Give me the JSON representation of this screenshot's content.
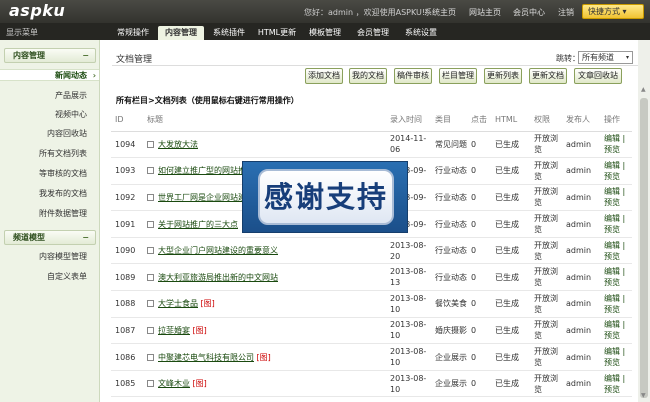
{
  "topbar": {
    "logo": "aspku",
    "welcome": "您好：admin ，欢迎使用ASPKU!",
    "links": [
      "系统主页",
      "网站主页",
      "会员中心",
      "注销"
    ],
    "shortcut": "快捷方式",
    "shortcut_arrow": "▾"
  },
  "navbar": {
    "menu_toggle": "显示菜单",
    "tabs": [
      "常规操作",
      "内容管理",
      "系统插件",
      "HTML更新",
      "模板管理",
      "会员管理",
      "系统设置"
    ],
    "active_tab": "内容管理"
  },
  "sidebar": {
    "sections": [
      {
        "title": "内容管理",
        "toggle": "−",
        "items": [
          "新闻动态",
          "产品展示",
          "视频中心",
          "内容回收站",
          "所有文档列表",
          "等审核的文档",
          "我发布的文档",
          "附件数据管理"
        ]
      },
      {
        "title": "频道模型",
        "toggle": "−",
        "items": [
          "内容模型管理",
          "自定义表单"
        ]
      }
    ],
    "active_item": "新闻动态",
    "active_marker": "›"
  },
  "main": {
    "title": "文档管理",
    "channel_label": "跳转：",
    "channel_value": "所有频道",
    "toolbar": [
      "添加文档",
      "我的文档",
      "稿件审核",
      "栏目管理",
      "更新列表",
      "更新文档",
      "文章回收站"
    ],
    "breadcrumb": "所有栏目>文档列表（使用鼠标右键进行常用操作）",
    "table": {
      "headers": [
        "ID",
        "标题",
        "录入时间",
        "类目",
        "点击",
        "HTML",
        "权限",
        "发布人",
        "操作"
      ],
      "rows": [
        {
          "id": "1094",
          "title": "大发放大法",
          "pic": "",
          "date": "2014-11-06",
          "cat": "常见问题",
          "clicks": "0",
          "html": "已生成",
          "perm": "开放浏览",
          "author": "admin",
          "ops": "编辑 | 预览"
        },
        {
          "id": "1093",
          "title": "如何建立推广型的网站推广",
          "pic": "",
          "date": "2013-09-",
          "cat": "行业动态",
          "clicks": "0",
          "html": "已生成",
          "perm": "开放浏览",
          "author": "admin",
          "ops": "编辑 | 预览"
        },
        {
          "id": "1092",
          "title": "世界工厂网是企业网站建设",
          "pic": "",
          "date": "2013-09-",
          "cat": "行业动态",
          "clicks": "0",
          "html": "已生成",
          "perm": "开放浏览",
          "author": "admin",
          "ops": "编辑 | 预览"
        },
        {
          "id": "1091",
          "title": "关于网站推广的三大点",
          "pic": "",
          "date": "2013-09-",
          "cat": "行业动态",
          "clicks": "0",
          "html": "已生成",
          "perm": "开放浏览",
          "author": "admin",
          "ops": "编辑 | 预览"
        },
        {
          "id": "1090",
          "title": "大型企业门户网站建设的重要意义",
          "pic": "",
          "date": "2013-08-20",
          "cat": "行业动态",
          "clicks": "0",
          "html": "已生成",
          "perm": "开放浏览",
          "author": "admin",
          "ops": "编辑 | 预览"
        },
        {
          "id": "1089",
          "title": "澳大利亚旅游局推出新的中文网站",
          "pic": "",
          "date": "2013-08-13",
          "cat": "行业动态",
          "clicks": "0",
          "html": "已生成",
          "perm": "开放浏览",
          "author": "admin",
          "ops": "编辑 | 预览"
        },
        {
          "id": "1088",
          "title": "大学士食品",
          "pic": "[图]",
          "date": "2013-08-10",
          "cat": "餐饮美食",
          "clicks": "0",
          "html": "已生成",
          "perm": "开放浏览",
          "author": "admin",
          "ops": "编辑 | 预览"
        },
        {
          "id": "1087",
          "title": "拉菲婚宴",
          "pic": "[图]",
          "date": "2013-08-10",
          "cat": "婚庆摄影",
          "clicks": "0",
          "html": "已生成",
          "perm": "开放浏览",
          "author": "admin",
          "ops": "编辑 | 预览"
        },
        {
          "id": "1086",
          "title": "中聚建芯电气科技有限公司",
          "pic": "[图]",
          "date": "2013-08-10",
          "cat": "企业展示",
          "clicks": "0",
          "html": "已生成",
          "perm": "开放浏览",
          "author": "admin",
          "ops": "编辑 | 预览"
        },
        {
          "id": "1085",
          "title": "文峰木业",
          "pic": "[图]",
          "date": "2013-08-10",
          "cat": "企业展示",
          "clicks": "0",
          "html": "已生成",
          "perm": "开放浏览",
          "author": "admin",
          "ops": "编辑 | 预览"
        }
      ]
    }
  },
  "overlay": {
    "text": "感谢支持"
  },
  "scroll": {
    "up": "▲",
    "down": "▼"
  },
  "colors": {
    "accent": "#1a4a0f",
    "topbar": "#3b3b36",
    "sidebar_bg": "#eef3e6",
    "shortcut": "#f0c232"
  }
}
